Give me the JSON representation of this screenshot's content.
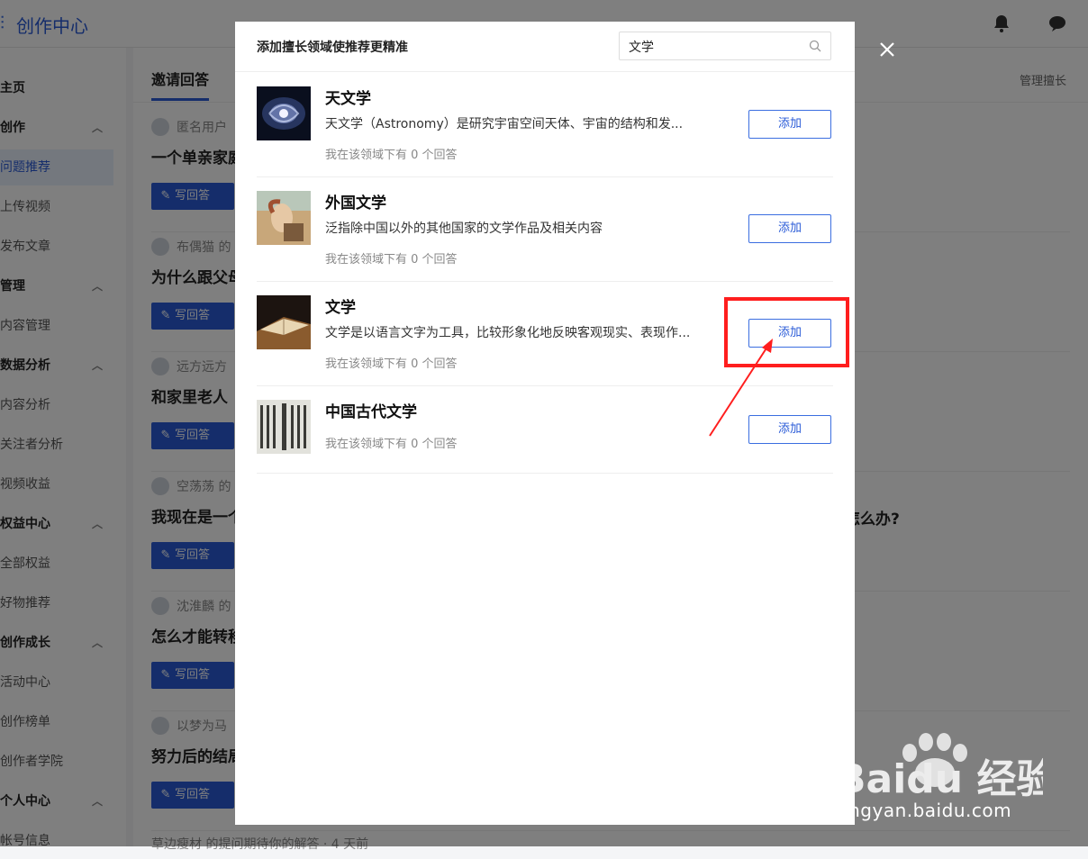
{
  "app": {
    "title": "创作中心"
  },
  "sidebar": {
    "items": [
      {
        "label": "主页",
        "type": "item"
      },
      {
        "label": "创作",
        "type": "group"
      },
      {
        "label": "问题推荐",
        "type": "active"
      },
      {
        "label": "上传视频",
        "type": "item"
      },
      {
        "label": "发布文章",
        "type": "item"
      },
      {
        "label": "管理",
        "type": "group"
      },
      {
        "label": "内容管理",
        "type": "item"
      },
      {
        "label": "数据分析",
        "type": "group"
      },
      {
        "label": "内容分析",
        "type": "item"
      },
      {
        "label": "关注者分析",
        "type": "item"
      },
      {
        "label": "视频收益",
        "type": "item"
      },
      {
        "label": "权益中心",
        "type": "group"
      },
      {
        "label": "全部权益",
        "type": "item"
      },
      {
        "label": "好物推荐",
        "type": "item"
      },
      {
        "label": "创作成长",
        "type": "group"
      },
      {
        "label": "活动中心",
        "type": "item"
      },
      {
        "label": "创作榜单",
        "type": "item"
      },
      {
        "label": "创作者学院",
        "type": "item"
      },
      {
        "label": "个人中心",
        "type": "group"
      },
      {
        "label": "帐号信息",
        "type": "item"
      }
    ]
  },
  "main": {
    "tab_invite": "邀请回答",
    "manage_link": "管理擅长",
    "answer_label": "写回答",
    "questions": [
      {
        "user": "匿名用户",
        "title": "一个单亲家庭"
      },
      {
        "user": "布偶猫 的",
        "title": "为什么跟父母"
      },
      {
        "user": "远方远方",
        "title": "和家里老人"
      },
      {
        "user": "空荡荡 的",
        "title": "我现在是一个"
      },
      {
        "user": "沈淮麟 的",
        "title": "怎么才能转移"
      },
      {
        "user": "以梦为马",
        "title": "努力后的结局"
      }
    ],
    "bottom_partial": "草边瘦材 的提问期待你的解答 · 4 天前",
    "right_fragment": "怎么办?"
  },
  "modal": {
    "title": "添加擅长领域使推荐更精准",
    "search": {
      "value": "文学"
    },
    "add_label": "添加",
    "fields": [
      {
        "name": "天文学",
        "desc": "天文学（Astronomy）是研究宇宙空间天体、宇宙的结构和发...",
        "count": "我在该领域下有 0 个回答",
        "thumb": "galaxy"
      },
      {
        "name": "外国文学",
        "desc": "泛指除中国以外的其他国家的文学作品及相关内容",
        "count": "我在该领域下有 0 个回答",
        "thumb": "painting"
      },
      {
        "name": "文学",
        "desc": "文学是以语言文字为工具，比较形象化地反映客观现实、表现作...",
        "count": "我在该领域下有 0 个回答",
        "thumb": "book"
      },
      {
        "name": "中国古代文学",
        "desc": "",
        "count": "我在该领域下有 0 个回答",
        "thumb": "scroll"
      }
    ]
  },
  "watermark": {
    "brand": "Baidu 经验",
    "url": "jingyan.baidu.com"
  },
  "colors": {
    "accent": "#2a5bd7",
    "highlight": "#ff1e1e"
  }
}
